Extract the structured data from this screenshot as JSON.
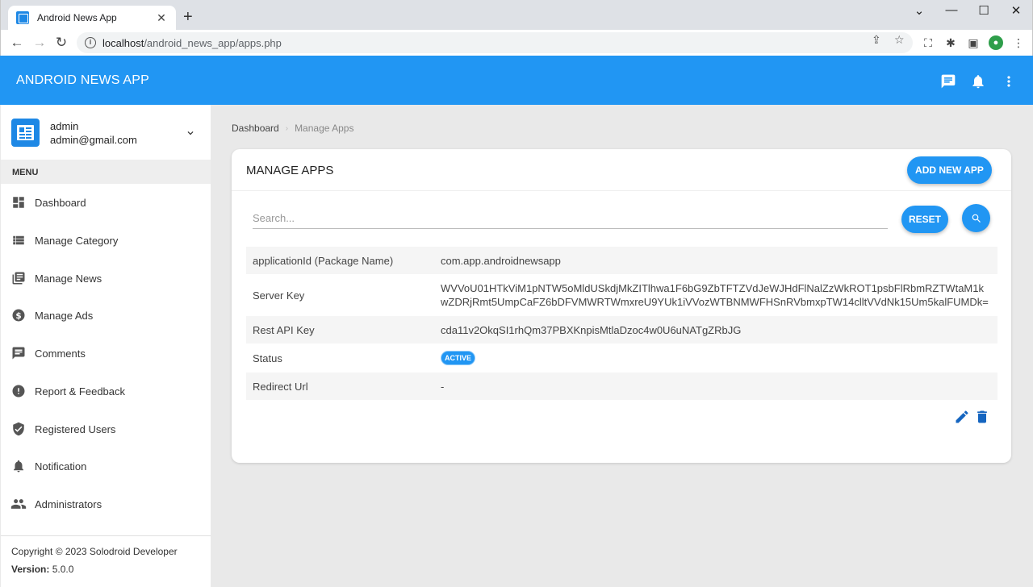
{
  "browser": {
    "tab_title": "Android News App",
    "url_host": "localhost",
    "url_path": "/android_news_app/apps.php"
  },
  "header": {
    "title": "ANDROID NEWS APP",
    "icons": [
      "message-icon",
      "bell-icon",
      "more-vert-icon"
    ]
  },
  "user": {
    "name": "admin",
    "email": "admin@gmail.com"
  },
  "sidebar": {
    "menu_header": "MENU",
    "items": [
      {
        "label": "Dashboard",
        "icon": "dashboard-icon"
      },
      {
        "label": "Manage Category",
        "icon": "list-icon"
      },
      {
        "label": "Manage News",
        "icon": "library-icon"
      },
      {
        "label": "Manage Ads",
        "icon": "dollar-icon"
      },
      {
        "label": "Comments",
        "icon": "comment-icon"
      },
      {
        "label": "Report & Feedback",
        "icon": "alert-icon"
      },
      {
        "label": "Registered Users",
        "icon": "shield-icon"
      },
      {
        "label": "Notification",
        "icon": "bell-icon"
      },
      {
        "label": "Administrators",
        "icon": "people-icon"
      }
    ],
    "copyright": "Copyright © 2023 Solodroid Developer",
    "version_label": "Version:",
    "version_value": "5.0.0"
  },
  "breadcrumb": {
    "home": "Dashboard",
    "current": "Manage Apps"
  },
  "card": {
    "title": "MANAGE APPS",
    "add_button": "ADD NEW APP",
    "search_placeholder": "Search...",
    "reset_button": "RESET"
  },
  "details": [
    {
      "label": "applicationId (Package Name)",
      "value": "com.app.androidnewsapp"
    },
    {
      "label": "Server Key",
      "value": "WVVoU01HTkViM1pNTW5oMldUSkdjMkZITlhwa1F6bG9ZbTFTZVdJeWJHdFlNalZzWkROT1psbFlRbmRZTWtaM1kwZDRjRmt5UmpCaFZ6bDFVMWRTWmxreU9YUk1iVVozWTBNMWFHSnRVbmxpTW14clltVVdNk15Um5kalFUMDk="
    },
    {
      "label": "Rest API Key",
      "value": "cda11v2OkqSI1rhQm37PBXKnpisMtlaDzoc4w0U6uNATgZRbJG"
    },
    {
      "label": "Status",
      "value": "ACTIVE"
    },
    {
      "label": "Redirect Url",
      "value": "-"
    }
  ],
  "colors": {
    "primary": "#2196f3",
    "sidebar_bg": "#ffffff",
    "content_bg": "#e9e9e9"
  }
}
